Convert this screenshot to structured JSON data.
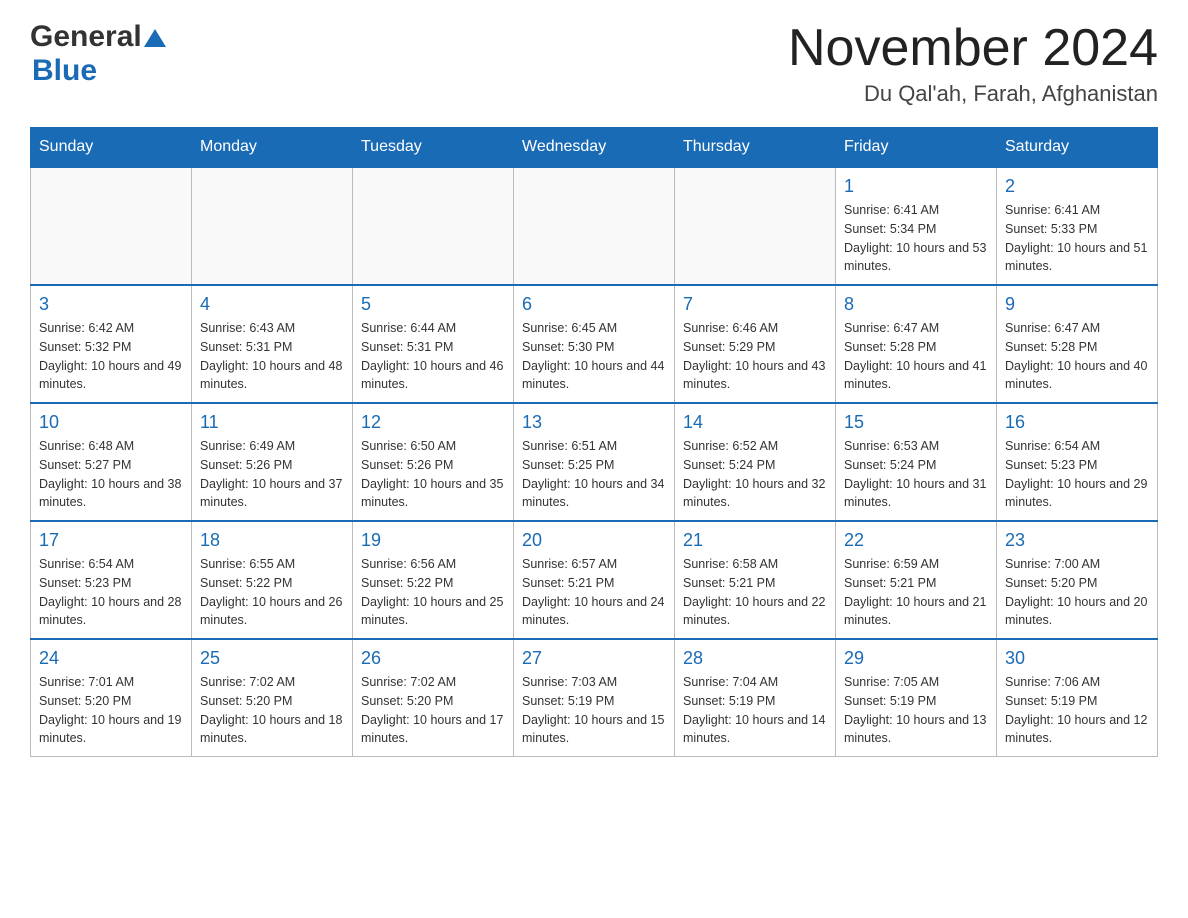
{
  "header": {
    "logo_general": "General",
    "logo_blue": "Blue",
    "title": "November 2024",
    "subtitle": "Du Qal'ah, Farah, Afghanistan"
  },
  "days_of_week": [
    "Sunday",
    "Monday",
    "Tuesday",
    "Wednesday",
    "Thursday",
    "Friday",
    "Saturday"
  ],
  "weeks": [
    [
      {
        "day": "",
        "info": ""
      },
      {
        "day": "",
        "info": ""
      },
      {
        "day": "",
        "info": ""
      },
      {
        "day": "",
        "info": ""
      },
      {
        "day": "",
        "info": ""
      },
      {
        "day": "1",
        "info": "Sunrise: 6:41 AM\nSunset: 5:34 PM\nDaylight: 10 hours and 53 minutes."
      },
      {
        "day": "2",
        "info": "Sunrise: 6:41 AM\nSunset: 5:33 PM\nDaylight: 10 hours and 51 minutes."
      }
    ],
    [
      {
        "day": "3",
        "info": "Sunrise: 6:42 AM\nSunset: 5:32 PM\nDaylight: 10 hours and 49 minutes."
      },
      {
        "day": "4",
        "info": "Sunrise: 6:43 AM\nSunset: 5:31 PM\nDaylight: 10 hours and 48 minutes."
      },
      {
        "day": "5",
        "info": "Sunrise: 6:44 AM\nSunset: 5:31 PM\nDaylight: 10 hours and 46 minutes."
      },
      {
        "day": "6",
        "info": "Sunrise: 6:45 AM\nSunset: 5:30 PM\nDaylight: 10 hours and 44 minutes."
      },
      {
        "day": "7",
        "info": "Sunrise: 6:46 AM\nSunset: 5:29 PM\nDaylight: 10 hours and 43 minutes."
      },
      {
        "day": "8",
        "info": "Sunrise: 6:47 AM\nSunset: 5:28 PM\nDaylight: 10 hours and 41 minutes."
      },
      {
        "day": "9",
        "info": "Sunrise: 6:47 AM\nSunset: 5:28 PM\nDaylight: 10 hours and 40 minutes."
      }
    ],
    [
      {
        "day": "10",
        "info": "Sunrise: 6:48 AM\nSunset: 5:27 PM\nDaylight: 10 hours and 38 minutes."
      },
      {
        "day": "11",
        "info": "Sunrise: 6:49 AM\nSunset: 5:26 PM\nDaylight: 10 hours and 37 minutes."
      },
      {
        "day": "12",
        "info": "Sunrise: 6:50 AM\nSunset: 5:26 PM\nDaylight: 10 hours and 35 minutes."
      },
      {
        "day": "13",
        "info": "Sunrise: 6:51 AM\nSunset: 5:25 PM\nDaylight: 10 hours and 34 minutes."
      },
      {
        "day": "14",
        "info": "Sunrise: 6:52 AM\nSunset: 5:24 PM\nDaylight: 10 hours and 32 minutes."
      },
      {
        "day": "15",
        "info": "Sunrise: 6:53 AM\nSunset: 5:24 PM\nDaylight: 10 hours and 31 minutes."
      },
      {
        "day": "16",
        "info": "Sunrise: 6:54 AM\nSunset: 5:23 PM\nDaylight: 10 hours and 29 minutes."
      }
    ],
    [
      {
        "day": "17",
        "info": "Sunrise: 6:54 AM\nSunset: 5:23 PM\nDaylight: 10 hours and 28 minutes."
      },
      {
        "day": "18",
        "info": "Sunrise: 6:55 AM\nSunset: 5:22 PM\nDaylight: 10 hours and 26 minutes."
      },
      {
        "day": "19",
        "info": "Sunrise: 6:56 AM\nSunset: 5:22 PM\nDaylight: 10 hours and 25 minutes."
      },
      {
        "day": "20",
        "info": "Sunrise: 6:57 AM\nSunset: 5:21 PM\nDaylight: 10 hours and 24 minutes."
      },
      {
        "day": "21",
        "info": "Sunrise: 6:58 AM\nSunset: 5:21 PM\nDaylight: 10 hours and 22 minutes."
      },
      {
        "day": "22",
        "info": "Sunrise: 6:59 AM\nSunset: 5:21 PM\nDaylight: 10 hours and 21 minutes."
      },
      {
        "day": "23",
        "info": "Sunrise: 7:00 AM\nSunset: 5:20 PM\nDaylight: 10 hours and 20 minutes."
      }
    ],
    [
      {
        "day": "24",
        "info": "Sunrise: 7:01 AM\nSunset: 5:20 PM\nDaylight: 10 hours and 19 minutes."
      },
      {
        "day": "25",
        "info": "Sunrise: 7:02 AM\nSunset: 5:20 PM\nDaylight: 10 hours and 18 minutes."
      },
      {
        "day": "26",
        "info": "Sunrise: 7:02 AM\nSunset: 5:20 PM\nDaylight: 10 hours and 17 minutes."
      },
      {
        "day": "27",
        "info": "Sunrise: 7:03 AM\nSunset: 5:19 PM\nDaylight: 10 hours and 15 minutes."
      },
      {
        "day": "28",
        "info": "Sunrise: 7:04 AM\nSunset: 5:19 PM\nDaylight: 10 hours and 14 minutes."
      },
      {
        "day": "29",
        "info": "Sunrise: 7:05 AM\nSunset: 5:19 PM\nDaylight: 10 hours and 13 minutes."
      },
      {
        "day": "30",
        "info": "Sunrise: 7:06 AM\nSunset: 5:19 PM\nDaylight: 10 hours and 12 minutes."
      }
    ]
  ]
}
